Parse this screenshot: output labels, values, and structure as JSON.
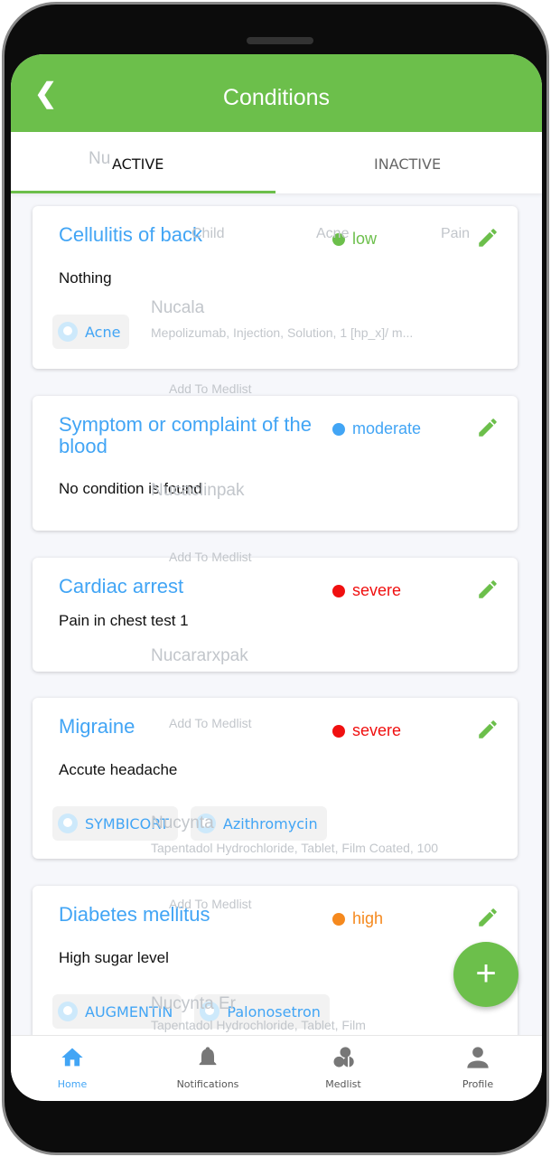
{
  "header": {
    "title": "Conditions",
    "back_icon": "chevron-left-icon"
  },
  "tabs": [
    {
      "label": "ACTIVE",
      "selected": true
    },
    {
      "label": "INACTIVE",
      "selected": false
    }
  ],
  "background_ghost": {
    "search_value": "Nu",
    "columns": [
      "Child",
      "Acne",
      "Pain"
    ],
    "items": [
      {
        "name": "Nucala",
        "desc": "Mepolizumab, Injection, Solution, 1 [hp_x]/ m...",
        "button": "Add To Medlist"
      },
      {
        "name": "Nucaclinpak",
        "desc": "--",
        "button": "Add To Medlist"
      },
      {
        "name": "Nucararxpak",
        "desc": "--",
        "button": "Add To Medlist"
      },
      {
        "name": "Nucynta",
        "desc": "Tapentadol Hydrochloride, Tablet, Film Coated, 100",
        "button": "Add To Medlist"
      },
      {
        "name": "Nucynta Er",
        "desc": "Tapentadol Hydrochloride, Tablet, Film",
        "button": ""
      }
    ]
  },
  "conditions": [
    {
      "title": "Cellulitis of back",
      "severity": "low",
      "severity_color": "#6cbf4b",
      "description": "Nothing",
      "tags": [
        "Acne"
      ]
    },
    {
      "title": "Symptom or complaint of the blood",
      "severity": "moderate",
      "severity_color": "#42a5f5",
      "description": "No condition is found",
      "tags": []
    },
    {
      "title": "Cardiac arrest",
      "severity": "severe",
      "severity_color": "#f01010",
      "description": "Pain in chest test 1",
      "tags": []
    },
    {
      "title": "Migraine",
      "severity": "severe",
      "severity_color": "#f01010",
      "description": "Accute headache",
      "tags": [
        "SYMBICORT",
        "Azithromycin"
      ]
    },
    {
      "title": "Diabetes mellitus",
      "severity": "high",
      "severity_color": "#f5891e",
      "description": "High sugar level",
      "tags": [
        "AUGMENTIN",
        "Palonosetron"
      ]
    }
  ],
  "fab": {
    "label": "+"
  },
  "nav": [
    {
      "label": "Home",
      "icon": "home-icon",
      "active": true
    },
    {
      "label": "Notifications",
      "icon": "bell-icon",
      "active": false
    },
    {
      "label": "Medlist",
      "icon": "pills-icon",
      "active": false
    },
    {
      "label": "Profile",
      "icon": "person-icon",
      "active": false
    }
  ],
  "colors": {
    "accent": "#6cbf4b",
    "link": "#42a5f5"
  }
}
